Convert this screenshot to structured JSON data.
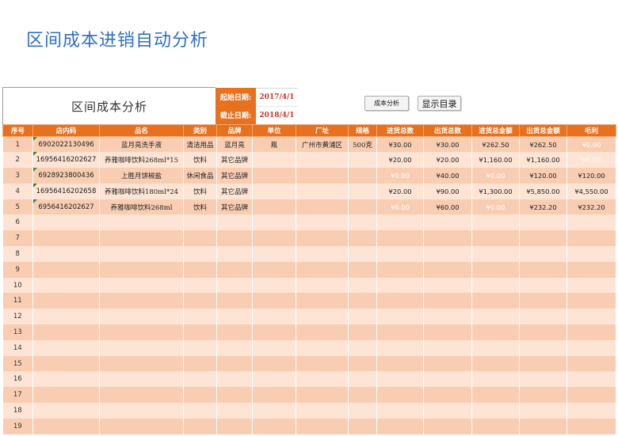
{
  "page": {
    "title": "区间成本进销自动分析"
  },
  "panel": {
    "title": "区间成本分析",
    "start_label": "起始日期:",
    "start_value": "2017/4/1",
    "end_label": "截止日期:",
    "end_value": "2018/4/1",
    "analyze_button": "成本分析",
    "menu_button": "显示目录"
  },
  "table": {
    "headers": [
      "序号",
      "店内码",
      "品名",
      "类别",
      "品牌",
      "单位",
      "厂址",
      "规格",
      "进货总数",
      "出货总数",
      "进货总金额",
      "出货总金额",
      "毛利"
    ],
    "rows": [
      [
        "1",
        "6902022130496",
        "蓝月亮洗手液",
        "清洁用品",
        "蓝月亮",
        "瓶",
        "广州市黄浦区",
        "500克",
        "¥30.00",
        "¥30.00",
        "¥262.50",
        "¥262.50",
        "¥0.00"
      ],
      [
        "2",
        "16956416202627",
        "养雅咖啡饮料268ml*15",
        "饮料",
        "其它品牌",
        "",
        "",
        "",
        "¥20.00",
        "¥20.00",
        "¥1,160.00",
        "¥1,160.00",
        "¥0.00"
      ],
      [
        "3",
        "6928923800436",
        "上胜月饼椒盐",
        "休闲食品",
        "其它品牌",
        "",
        "",
        "",
        "¥0.00",
        "¥40.00",
        "¥0.00",
        "¥120.00",
        "¥120.00"
      ],
      [
        "4",
        "16956416202658",
        "养雅咖啡饮料180ml*24",
        "饮料",
        "其它品牌",
        "",
        "",
        "",
        "¥20.00",
        "¥90.00",
        "¥1,300.00",
        "¥5,850.00",
        "¥4,550.00"
      ],
      [
        "5",
        "6956416202627",
        "养雅咖啡饮料268ml",
        "饮料",
        "其它品牌",
        "",
        "",
        "",
        "¥0.00",
        "¥60.00",
        "¥0.00",
        "¥232.20",
        "¥232.20"
      ],
      [
        "6",
        "",
        "",
        "",
        "",
        "",
        "",
        "",
        "",
        "",
        "",
        "",
        ""
      ],
      [
        "7",
        "",
        "",
        "",
        "",
        "",
        "",
        "",
        "",
        "",
        "",
        "",
        ""
      ],
      [
        "8",
        "",
        "",
        "",
        "",
        "",
        "",
        "",
        "",
        "",
        "",
        "",
        ""
      ],
      [
        "9",
        "",
        "",
        "",
        "",
        "",
        "",
        "",
        "",
        "",
        "",
        "",
        ""
      ],
      [
        "10",
        "",
        "",
        "",
        "",
        "",
        "",
        "",
        "",
        "",
        "",
        "",
        ""
      ],
      [
        "11",
        "",
        "",
        "",
        "",
        "",
        "",
        "",
        "",
        "",
        "",
        "",
        ""
      ],
      [
        "12",
        "",
        "",
        "",
        "",
        "",
        "",
        "",
        "",
        "",
        "",
        "",
        ""
      ],
      [
        "13",
        "",
        "",
        "",
        "",
        "",
        "",
        "",
        "",
        "",
        "",
        "",
        ""
      ],
      [
        "14",
        "",
        "",
        "",
        "",
        "",
        "",
        "",
        "",
        "",
        "",
        "",
        ""
      ],
      [
        "15",
        "",
        "",
        "",
        "",
        "",
        "",
        "",
        "",
        "",
        "",
        "",
        ""
      ],
      [
        "16",
        "",
        "",
        "",
        "",
        "",
        "",
        "",
        "",
        "",
        "",
        "",
        ""
      ],
      [
        "17",
        "",
        "",
        "",
        "",
        "",
        "",
        "",
        "",
        "",
        "",
        "",
        ""
      ],
      [
        "18",
        "",
        "",
        "",
        "",
        "",
        "",
        "",
        "",
        "",
        "",
        "",
        ""
      ],
      [
        "19",
        "",
        "",
        "",
        "",
        "",
        "",
        "",
        "",
        "",
        "",
        "",
        ""
      ]
    ]
  },
  "colors": {
    "title": "#2e6fc4",
    "header_bg": "#e8711f",
    "row_odd": "#f8cdb2",
    "row_even": "#fde4d4",
    "date_value": "#c0392b"
  }
}
